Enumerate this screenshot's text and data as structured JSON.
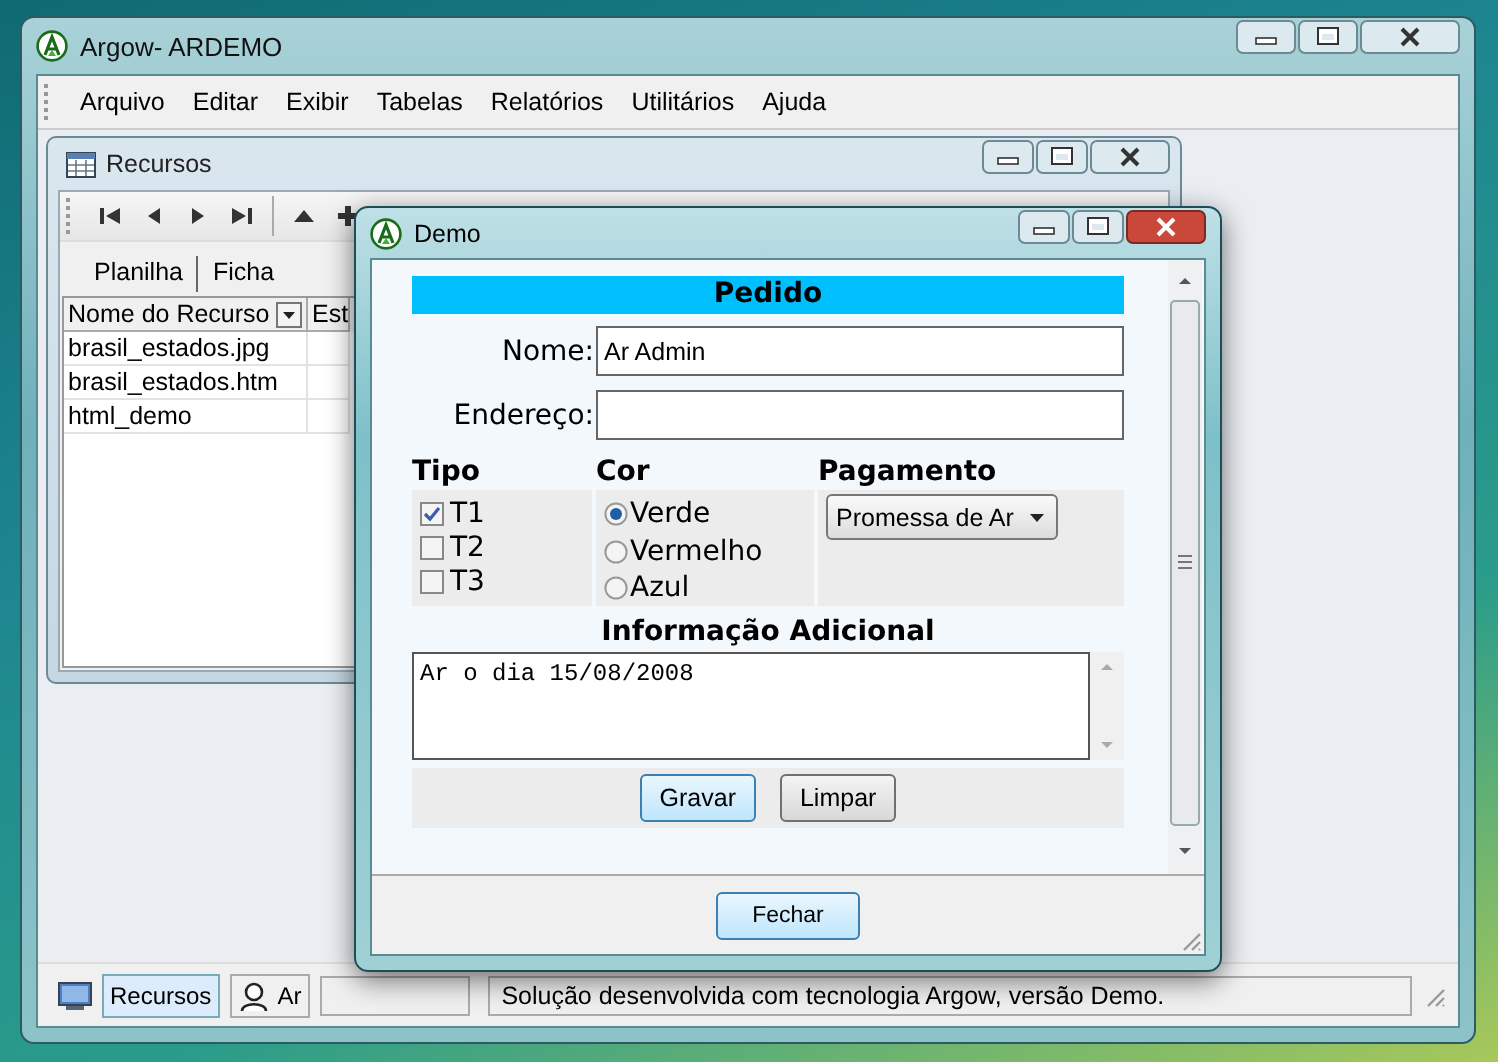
{
  "main_window": {
    "title": "Argow- ARDEMO"
  },
  "menu": [
    "Arquivo",
    "Editar",
    "Exibir",
    "Tabelas",
    "Relatórios",
    "Utilitários",
    "Ajuda"
  ],
  "resources_window": {
    "title": "Recursos",
    "tabs": [
      "Planilha",
      "Ficha"
    ],
    "columns": [
      "Nome do Recurso",
      "Est"
    ],
    "rows": [
      [
        "brasil_estados.jpg",
        ""
      ],
      [
        "brasil_estados.htm",
        ""
      ],
      [
        "html_demo",
        ""
      ]
    ]
  },
  "dialog": {
    "title": "Demo",
    "header": "Pedido",
    "fields": [
      {
        "label": "Nome:",
        "value": "Ar Admin"
      },
      {
        "label": "Endereço:"
      }
    ],
    "type_group": {
      "title": "Tipo",
      "options": [
        {
          "label": "T1",
          "checked": true
        },
        {
          "label": "T2",
          "checked": false
        },
        {
          "label": "T3",
          "checked": false
        }
      ]
    },
    "color_group": {
      "title": "Cor",
      "options": [
        {
          "label": "Verde",
          "selected": true
        },
        {
          "label": "Vermelho",
          "selected": false
        },
        {
          "label": "Azul",
          "selected": false
        }
      ]
    },
    "payment_group": {
      "title": "Pagamento",
      "value": "Promessa de Ar"
    },
    "notes": {
      "label": "Informação Adicional",
      "value": "Ar o dia 15/08/2008"
    },
    "buttons": [
      {
        "label": "Gravar",
        "focused": true
      },
      {
        "label": "Limpar",
        "focused": false
      }
    ],
    "close_button": "Fechar"
  },
  "status_bar": {
    "tasks": [
      {
        "label": "Recursos",
        "selected": true,
        "kind": "monitor"
      },
      {
        "label": "Ar",
        "selected": false,
        "kind": "person"
      }
    ],
    "message": "Solução desenvolvida com tecnologia Argow, versão Demo."
  }
}
